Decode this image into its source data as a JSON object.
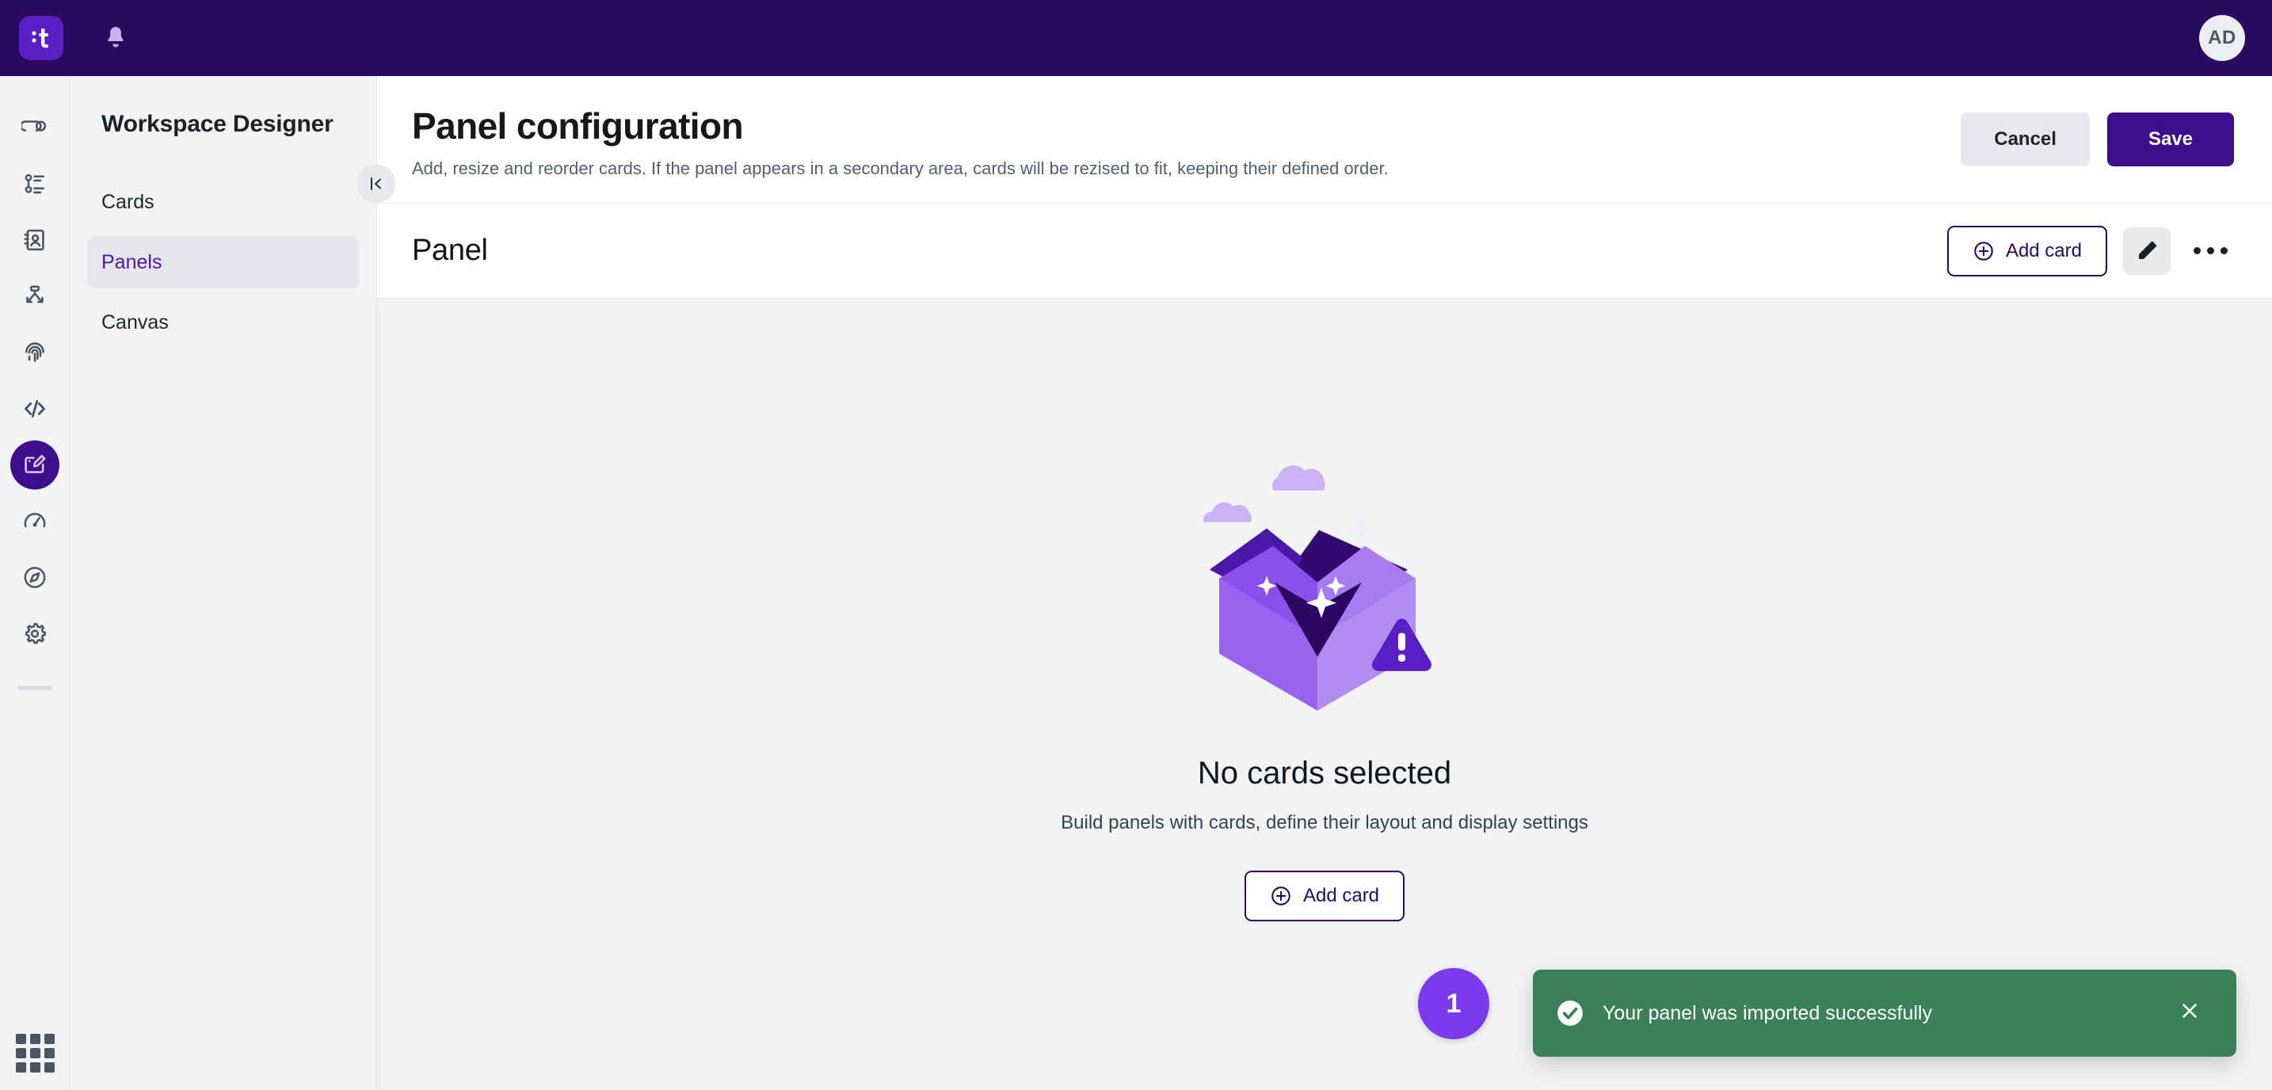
{
  "topbar": {
    "logo_label": "it-logo",
    "notifications_label": "bell-icon",
    "avatar_initials": "AD"
  },
  "rail": {
    "items": [
      {
        "name": "journeys",
        "icon": "journey-icon"
      },
      {
        "name": "sequences",
        "icon": "timeline-list-icon"
      },
      {
        "name": "contacts",
        "icon": "contact-book-icon"
      },
      {
        "name": "branching",
        "icon": "branch-split-icon"
      },
      {
        "name": "identity",
        "icon": "fingerprint-icon"
      },
      {
        "name": "developer",
        "icon": "code-icon"
      },
      {
        "name": "designer",
        "icon": "designer-icon",
        "active": true
      },
      {
        "name": "performance",
        "icon": "gauge-icon"
      },
      {
        "name": "explore",
        "icon": "compass-icon"
      },
      {
        "name": "settings",
        "icon": "gear-icon"
      }
    ],
    "app_switcher": "grid-icon"
  },
  "sidebar": {
    "title": "Workspace Designer",
    "collapse_icon": "collapse-left-icon",
    "items": [
      {
        "label": "Cards",
        "selected": false
      },
      {
        "label": "Panels",
        "selected": true
      },
      {
        "label": "Canvas",
        "selected": false
      }
    ]
  },
  "header": {
    "title": "Panel configuration",
    "subtitle": "Add, resize and reorder cards. If the panel appears in a secondary area, cards will be rezised to fit, keeping their defined order.",
    "cancel_label": "Cancel",
    "save_label": "Save"
  },
  "panel": {
    "name": "Panel",
    "add_card_label": "Add card",
    "edit_icon": "pencil-icon",
    "more_icon": "more-horizontal-icon"
  },
  "empty_state": {
    "illustration": "empty-box-illustration",
    "title": "No cards selected",
    "subtitle": "Build panels with cards, define their layout and display settings",
    "add_card_label": "Add card"
  },
  "toast": {
    "badge_number": "1",
    "message": "Your panel was imported successfully",
    "status_icon": "check-circle-icon",
    "close_icon": "close-icon",
    "background_color": "#3a8158"
  },
  "colors": {
    "brand_dark": "#2a0a5e",
    "brand": "#3d0f8f",
    "accent": "#7c3aed",
    "surface": "#f1f3f5",
    "success": "#3a8158"
  }
}
